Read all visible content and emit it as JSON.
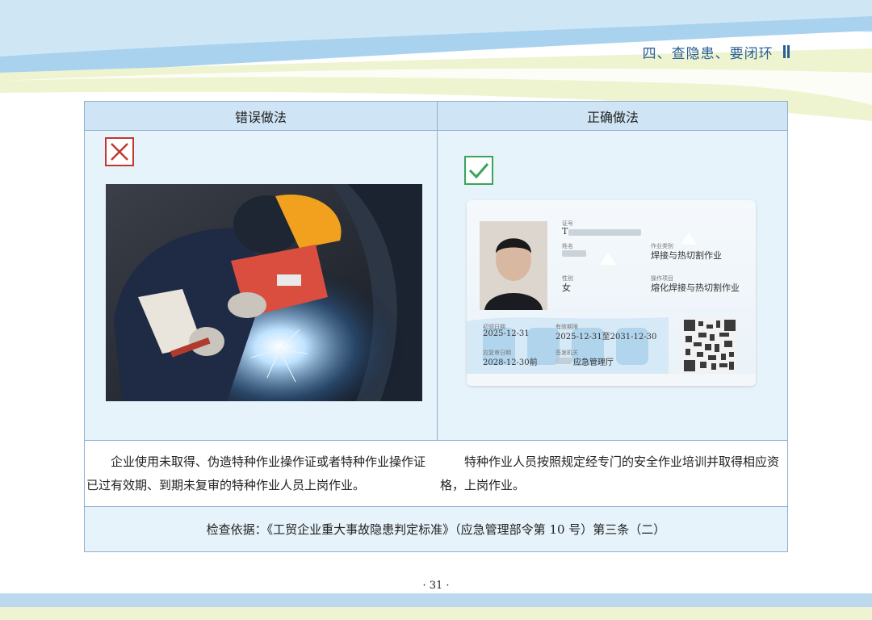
{
  "header": {
    "section_title": "四、查隐患、要闭环"
  },
  "table": {
    "col_wrong": "错误做法",
    "col_right": "正确做法",
    "wrong_text": "企业使用未取得、伪造特种作业操作证或者特种作业操作证已过有效期、到期未复审的特种作业人员上岗作业。",
    "right_text": "特种作业人员按照规定经专门的安全作业培训并取得相应资格，上岗作业。",
    "basis": "检查依据：《工贸企业重大事故隐患判定标准》（应急管理部令第 10 号）第三条（二）"
  },
  "id_card": {
    "label_id": "证号",
    "id_value": "T",
    "label_name": "姓名",
    "label_category": "作业类别",
    "category_value": "焊接与热切割作业",
    "label_gender": "性别",
    "gender_value": "女",
    "label_item": "操作项目",
    "item_value": "熔化焊接与热切割作业",
    "label_first": "初领日期",
    "first_value": "2025-12-31",
    "label_valid": "有效期限",
    "valid_value": "2025-12-31至2031-12-30",
    "label_review": "应复审日期",
    "review_value": "2028-12-30前",
    "label_issuer": "签发机关",
    "issuer_value": "应急管理厅"
  },
  "icons": {
    "wrong": "cross-icon",
    "right": "check-icon"
  },
  "colors": {
    "accent": "#2a5f95",
    "wrong": "#c0392b",
    "right": "#3aa35a"
  },
  "footer": {
    "page_number": "· 31 ·"
  }
}
